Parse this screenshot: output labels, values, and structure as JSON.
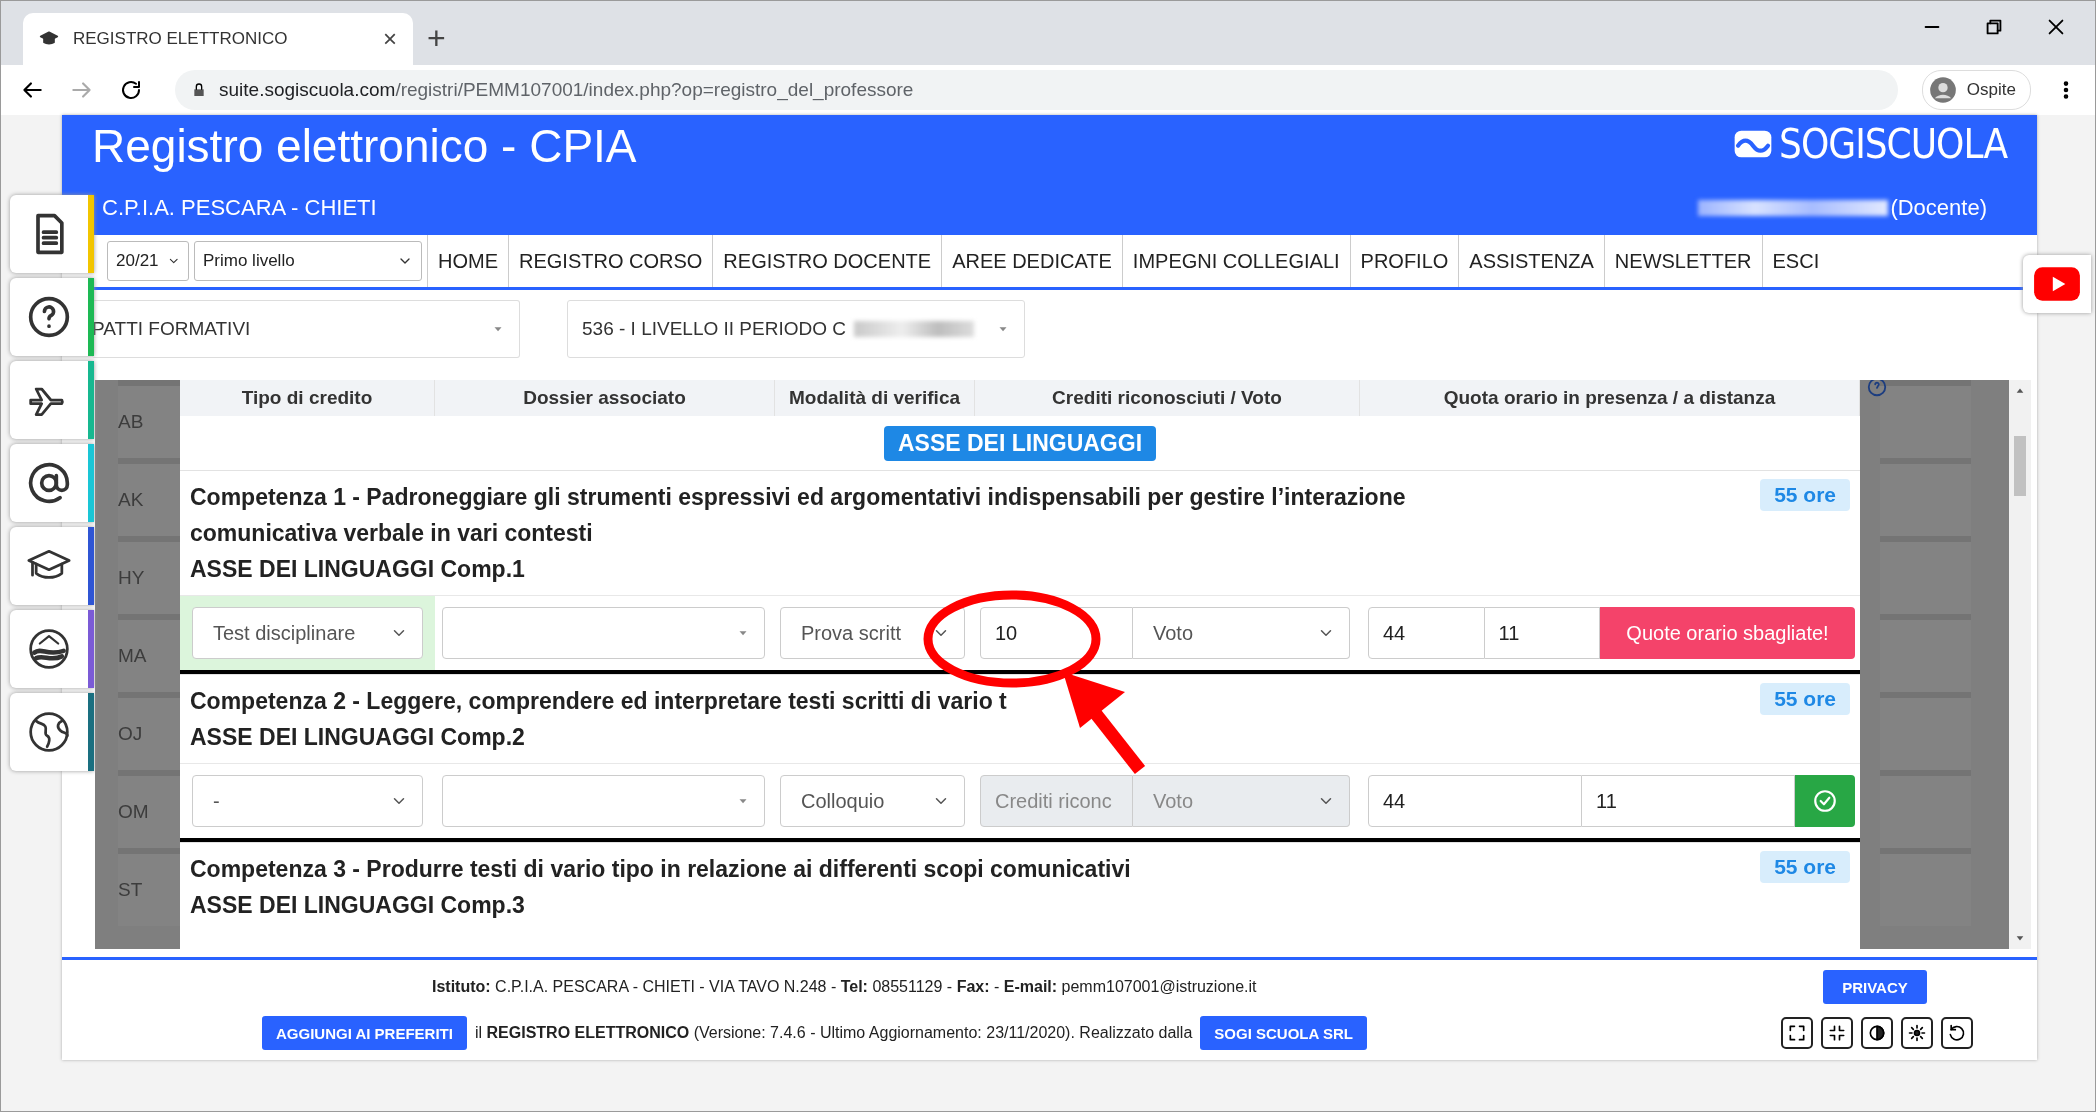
{
  "browser": {
    "tab_title": "REGISTRO ELETTRONICO",
    "tab_close": "×",
    "new_tab": "+",
    "url_host": "suite.sogiscuola.com",
    "url_path": "/registri/PEMM107001/index.php?op=registro_del_professore",
    "profile": "Ospite"
  },
  "header": {
    "title": "Registro elettronico - CPIA",
    "logo": "**SOGI**SCUOLA",
    "school": "C.P.I.A. PESCARA - CHIETI",
    "user_redacted": true,
    "role": "(Docente)"
  },
  "nav": {
    "year": "20/21",
    "level": "Primo livello",
    "items": [
      "HOME",
      "REGISTRO CORSO",
      "REGISTRO DOCENTE",
      "AREE DEDICATE",
      "IMPEGNI COLLEGIALI",
      "PROFILO",
      "ASSISTENZA",
      "NEWSLETTER",
      "ESCI"
    ]
  },
  "filters": [
    {
      "value": "PATTI FORMATIVI",
      "redacted": false
    },
    {
      "value": "536 - I LIVELLO II PERIODO C",
      "redacted": true
    }
  ],
  "background_rows": [
    "AB",
    "AK",
    "HY",
    "MA",
    "OJ",
    "OM",
    "ST"
  ],
  "modal": {
    "columns": [
      "Tipo di credito",
      "Dossier associato",
      "Modalità di verifica",
      "Crediti riconosciuti / Voto",
      "Quota orario in presenza / a distanza"
    ],
    "axis": "ASSE DEI LINGUAGGI",
    "competences": [
      {
        "title": "Competenza 1 - Padroneggiare gli strumenti espressivi ed argomentativi indispensabili per gestire l’interazione comunicativa verbale in vari contesti",
        "code": "ASSE DEI LINGUAGGI Comp.1",
        "hours": "55 ore",
        "controls": {
          "tipo": {
            "value": "Test disciplinare",
            "valid": true
          },
          "modalita": "Prova scritt",
          "crediti": {
            "value": "10",
            "disabled": false
          },
          "voto": {
            "value": "Voto",
            "disabled": false
          },
          "presenza": "44",
          "distanza": "11",
          "status": {
            "kind": "error",
            "text": "Quote orario sbagliate!"
          }
        }
      },
      {
        "title": "Competenza 2 - Leggere, comprendere ed interpretare testi scritti di vario t",
        "code": "ASSE DEI LINGUAGGI Comp.2",
        "hours": "55 ore",
        "controls": {
          "tipo": {
            "value": "-",
            "valid": false
          },
          "modalita": "Colloquio",
          "crediti": {
            "placeholder": "Crediti riconc",
            "disabled": true
          },
          "voto": {
            "value": "Voto",
            "disabled": true
          },
          "presenza": "44",
          "distanza": "11",
          "status": {
            "kind": "ok"
          }
        }
      },
      {
        "title": "Competenza 3 - Produrre testi di vario tipo in relazione ai differenti scopi comunicativi",
        "code": "ASSE DEI LINGUAGGI Comp.3",
        "hours": "55 ore"
      }
    ]
  },
  "footer": {
    "info": "**Istituto:** C.P.I.A. PESCARA - CHIETI - VIA TAVO N.248 - **Tel:** 08551129 - **Fax:** - **E-mail:** pemm107001@istruzione.it",
    "privacy": "PRIVACY",
    "favorites": "AGGIUNGI AI PREFERITI",
    "credits": "il **REGISTRO ELETTRONICO** (Versione: 7.4.6 - Ultimo Aggiornamento: 23/11/2020). Realizzato dalla",
    "company": "SOGI SCUOLA SRL"
  }
}
